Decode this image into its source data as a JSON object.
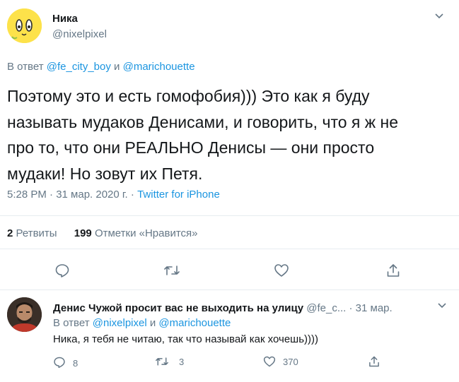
{
  "tweet": {
    "author_name": "Ника",
    "author_handle": "@nixelpixel",
    "reply_prefix": "В ответ",
    "reply_user1": "@fe_city_boy",
    "reply_and": "и",
    "reply_user2": "@marichouette",
    "text_line1": "Поэтому это и есть гомофобия))) Это как я буду",
    "text_line2": "называть мудаков Денисами, и говорить, что я ж не",
    "text_line3": "про то, что они РЕАЛЬНО Денисы — они просто",
    "text_line4": "мудаки! Но зовут их Петя.",
    "time": "5:28 PM · 31 мар. 2020 г. ·",
    "source": "Twitter for iPhone",
    "retweets_count": "2",
    "retweets_label": "Ретвиты",
    "likes_count": "199",
    "likes_label": "Отметки «Нравится»"
  },
  "reply": {
    "author_name": "Денис Чужой просит вас не выходить на улицу",
    "author_handle": "@fe_c...",
    "date": "· 31 мар.",
    "reply_prefix": "В ответ",
    "reply_user1": "@nixelpixel",
    "reply_and": "и",
    "reply_user2": "@marichouette",
    "text": "Ника, я тебя не читаю, так что называй как хочешь))))",
    "replies_count": "8",
    "retweets_count": "3",
    "likes_count": "370"
  },
  "icons": {
    "reply": "comment-icon",
    "retweet": "retweet-icon",
    "like": "heart-icon",
    "share": "share-icon",
    "more": "chevron-down-icon"
  },
  "colors": {
    "accent": "#1b95e0",
    "secondary_text": "#657786",
    "divider": "#e6ecf0",
    "icon": "#657786"
  }
}
